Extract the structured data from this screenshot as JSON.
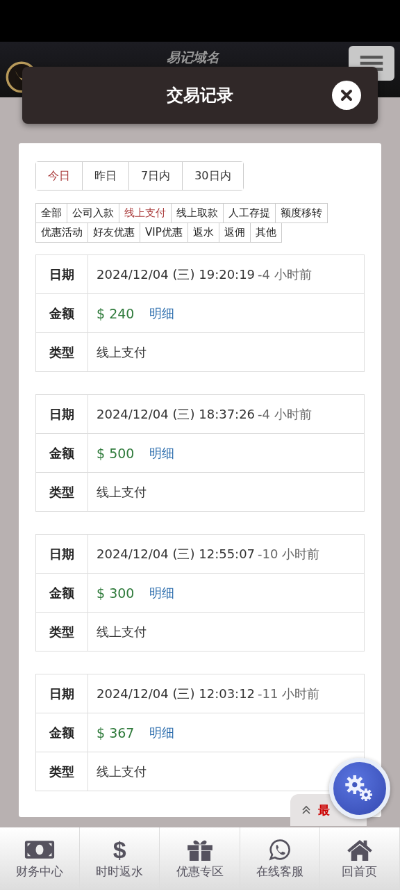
{
  "header": {
    "slogan": "易记域名"
  },
  "modal": {
    "title": "交易记录"
  },
  "date_tabs": [
    {
      "label": "今日",
      "selected": true
    },
    {
      "label": "昨日",
      "selected": false
    },
    {
      "label": "7日内",
      "selected": false
    },
    {
      "label": "30日内",
      "selected": false
    }
  ],
  "filters": [
    {
      "label": "全部",
      "selected": false
    },
    {
      "label": "公司入款",
      "selected": false
    },
    {
      "label": "线上支付",
      "selected": true
    },
    {
      "label": "线上取款",
      "selected": false
    },
    {
      "label": "人工存提",
      "selected": false
    },
    {
      "label": "额度移转",
      "selected": false
    },
    {
      "label": "优惠活动",
      "selected": false
    },
    {
      "label": "好友优惠",
      "selected": false
    },
    {
      "label": "VIP优惠",
      "selected": false
    },
    {
      "label": "返水",
      "selected": false
    },
    {
      "label": "返佣",
      "selected": false
    },
    {
      "label": "其他",
      "selected": false
    }
  ],
  "records": [
    {
      "date_label": "日期",
      "date": "2024/12/04 (三) 19:20:19",
      "ago": "-4 小时前",
      "amount_label": "金额",
      "amount": "$ 240",
      "detail": "明细",
      "type_label": "类型",
      "type": "线上支付"
    },
    {
      "date_label": "日期",
      "date": "2024/12/04 (三) 18:37:26",
      "ago": "-4 小时前",
      "amount_label": "金额",
      "amount": "$ 500",
      "detail": "明细",
      "type_label": "类型",
      "type": "线上支付"
    },
    {
      "date_label": "日期",
      "date": "2024/12/04 (三) 12:55:07",
      "ago": "-10 小时前",
      "amount_label": "金额",
      "amount": "$ 300",
      "detail": "明细",
      "type_label": "类型",
      "type": "线上支付"
    },
    {
      "date_label": "日期",
      "date": "2024/12/04 (三) 12:03:12",
      "ago": "-11 小时前",
      "amount_label": "金额",
      "amount": "$ 367",
      "detail": "明细",
      "type_label": "类型",
      "type": "线上支付"
    }
  ],
  "back_top": {
    "label": "最"
  },
  "nav": [
    {
      "kind": "cash",
      "label": "财务中心"
    },
    {
      "kind": "glyph",
      "glyph": "$",
      "label": "时时返水"
    },
    {
      "kind": "gift",
      "label": "优惠专区"
    },
    {
      "kind": "chat",
      "label": "在线客服"
    },
    {
      "kind": "home",
      "label": "回首页"
    }
  ]
}
